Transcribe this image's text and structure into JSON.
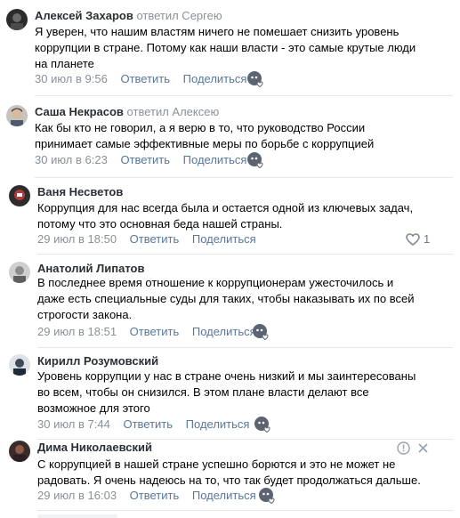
{
  "comments": [
    {
      "author": "Алексей Захаров",
      "replied": "ответил Сергею",
      "text_lines": [
        "Я уверен, что нашим властям ничего не помешает снизить уровень",
        "коррупции в стране. Потому как наши власти - это самые крутые люди",
        "на планете"
      ],
      "date": "30 июл в 9:56",
      "reply": "Ответить",
      "share": "Поделиться"
    },
    {
      "author": "Саша Некрасов",
      "replied": "ответил Алексею",
      "text_lines": [
        "Как бы кто не говорил, а я верю в то, что руководство России",
        "принимает самые эффективные меры по борьбе с коррупцией"
      ],
      "date": "30 июл в 6:23",
      "reply": "Ответить",
      "share": "Поделиться"
    },
    {
      "author": "Ваня Несветов",
      "replied": "",
      "text_lines": [
        "Коррупция для нас всегда была и остается одной из ключевых задач,",
        "потому что это основная беда нашей страны."
      ],
      "date": "29 июл в 18:50",
      "reply": "Ответить",
      "share": "Поделиться",
      "likes": "1"
    },
    {
      "author": "Анатолий Липатов",
      "replied": "",
      "text_lines": [
        "В последнее время отношение к коррупционерам ужесточилось и",
        "даже есть специальные суды для таких, чтобы наказывать их по всей",
        "строгости закона."
      ],
      "date": "29 июл в 18:51",
      "reply": "Ответить",
      "share": "Поделиться"
    },
    {
      "author": "Кирилл Розумовский",
      "replied": "",
      "text_lines": [
        "Уровень коррупции у нас в стране очень низкий и мы заинтересованы",
        "во всем, чтобы он снизился. В этом плане власти делают все",
        "возможное для этого"
      ],
      "date": "30 июл в 7:44",
      "reply": "Ответить",
      "share": "Поделиться"
    },
    {
      "author": "Дима Николаевский",
      "replied": "",
      "text_lines": [
        "С коррупцией в нашей стране успешно борются и это не может не",
        "радовать. Я очень надеюсь на то, что так будет продолжаться дальше."
      ],
      "date": "29 июл в 16:03",
      "reply": "Ответить",
      "share": "Поделиться"
    }
  ],
  "icons": {
    "reaction": "reactions-icon",
    "heart": "heart-icon",
    "report": "report-icon",
    "close": "close-icon"
  },
  "colors": {
    "link": "#58779b",
    "meta": "#8a9099",
    "divider": "#e7e8ec"
  }
}
